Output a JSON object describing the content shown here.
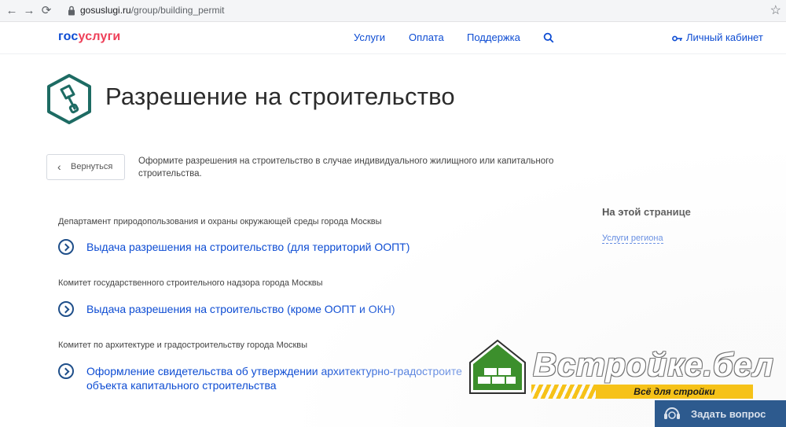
{
  "browser": {
    "url_host": "gosuslugi.ru",
    "url_path": "/group/building_permit"
  },
  "header": {
    "logo_part1": "гос",
    "logo_part2": "услуги",
    "nav": [
      "Услуги",
      "Оплата",
      "Поддержка"
    ],
    "cabinet_label": "Личный кабинет"
  },
  "page": {
    "title": "Разрешение на строительство",
    "back_label": "Вернуться",
    "description": "Оформите разрешения на строительство в случае индивидуального жилищного или капитального строительства."
  },
  "services": [
    {
      "department": "Департамент природопользования и охраны окружающей среды города Москвы",
      "link": "Выдача разрешения на строительство (для территорий ООПТ)"
    },
    {
      "department": "Комитет государственного строительного надзора города Москвы",
      "link": "Выдача разрешения на строительство (кроме ООПТ и ОКН)"
    },
    {
      "department": "Комитет по архитектуре и градостроительству города Москвы",
      "link_line1": "Оформление свидетельства об утверждении архитектурно-градостроите",
      "link_line2": "объекта капитального строительства"
    }
  ],
  "aside": {
    "title": "На этой странице",
    "link": "Услуги региона"
  },
  "watermark": {
    "brand": "Встройке.бел",
    "tagline": "Всё для стройки"
  },
  "ask_button": "Задать вопрос",
  "colors": {
    "link_blue": "#0d4cd3",
    "logo_red": "#ee3f58",
    "icon_teal": "#1d6b63",
    "brand_green": "#3c8f2c",
    "brand_yellow": "#f6c218",
    "ask_bg": "#2d5a8e"
  }
}
